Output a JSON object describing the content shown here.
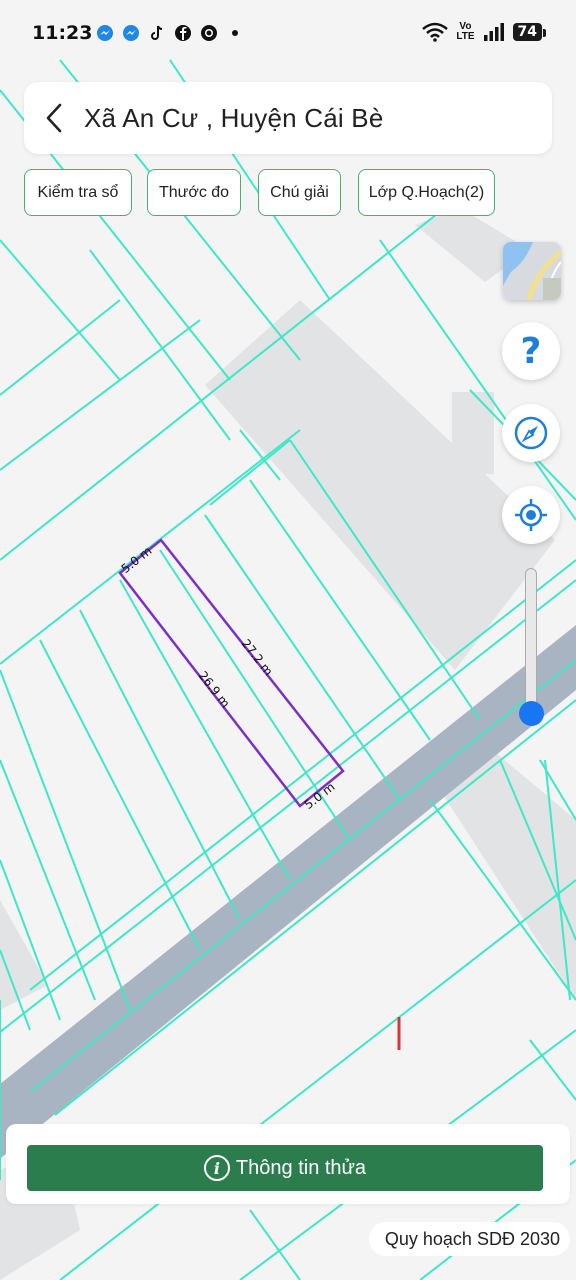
{
  "status_bar": {
    "time": "11:23",
    "app_icons": [
      "messenger-icon",
      "messenger-icon",
      "tiktok-icon",
      "facebook-icon",
      "chrome-icon",
      "dot-icon"
    ],
    "volte": "Vo",
    "lte": "LTE",
    "battery": "74"
  },
  "header": {
    "title": "Xã An Cư , Huyện Cái Bè",
    "back_icon": "chevron-left-icon"
  },
  "chips": [
    {
      "label": "Kiểm tra sổ"
    },
    {
      "label": "Thước đo"
    },
    {
      "label": "Chú giải"
    },
    {
      "label": "Lớp Q.Hoạch(2)"
    }
  ],
  "map_controls": {
    "layer_icon": "map-layer-icon",
    "help_icon": "help-icon",
    "compass_icon": "compass-icon",
    "locate_icon": "my-location-icon",
    "zoom_level": 0.9
  },
  "parcel": {
    "top_edge": "5.0 m",
    "right_edge": "27.2 m",
    "left_edge": "26.9 m",
    "bottom_edge": "5.0 m",
    "outline_color": "#7b2fc7"
  },
  "colors": {
    "parcel_lines": "#3de8c8",
    "road": "#a9b4c2",
    "building": "#e2e3e5",
    "accent": "#2c7d4e",
    "control_blue": "#1e7fd6"
  },
  "bottom": {
    "info_button": "Thông tin thửa",
    "plan_label": "Quy hoạch SDĐ 2030"
  }
}
